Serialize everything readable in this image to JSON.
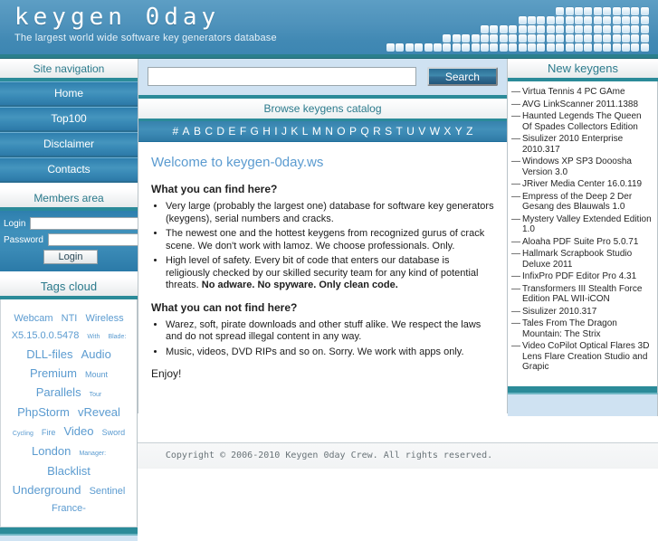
{
  "header": {
    "title": "keygen 0day",
    "tagline": "The largest world wide software key generators database"
  },
  "sidebar_left": {
    "nav_heading": "Site navigation",
    "nav_items": [
      {
        "label": "Home"
      },
      {
        "label": "Top100"
      },
      {
        "label": "Disclaimer"
      },
      {
        "label": "Contacts"
      }
    ],
    "members_heading": "Members area",
    "login_label": "Login",
    "password_label": "Password",
    "login_value": "",
    "password_value": "",
    "login_button": "Login",
    "tags_heading": "Tags cloud",
    "tags": [
      {
        "label": "Webcam",
        "size": "s3"
      },
      {
        "label": "NTI",
        "size": "s3"
      },
      {
        "label": "Wireless",
        "size": "s3"
      },
      {
        "label": "X5.15.0.0.5478",
        "size": "s3"
      },
      {
        "label": "With",
        "size": "s1"
      },
      {
        "label": "Blade:",
        "size": "s1"
      },
      {
        "label": "DLL-files",
        "size": "s4"
      },
      {
        "label": "Audio",
        "size": "s4"
      },
      {
        "label": "Premium",
        "size": "s4"
      },
      {
        "label": "Mount",
        "size": "s2"
      },
      {
        "label": "Parallels",
        "size": "s4"
      },
      {
        "label": "Tour",
        "size": "s1"
      },
      {
        "label": "PhpStorm",
        "size": "s4"
      },
      {
        "label": "vReveal",
        "size": "s4"
      },
      {
        "label": "Cycling",
        "size": "s1"
      },
      {
        "label": "Fire",
        "size": "s2"
      },
      {
        "label": "Video",
        "size": "s4"
      },
      {
        "label": "Sword",
        "size": "s2"
      },
      {
        "label": "London",
        "size": "s4"
      },
      {
        "label": "Manager:",
        "size": "s1"
      },
      {
        "label": "Blacklist",
        "size": "s4"
      },
      {
        "label": "Underground",
        "size": "s4"
      },
      {
        "label": "Sentinel",
        "size": "s3"
      },
      {
        "label": "France-",
        "size": "s3"
      }
    ]
  },
  "search": {
    "value": "",
    "placeholder": "",
    "button_label": "Search"
  },
  "catalog": {
    "heading": "Browse keygens catalog",
    "letters": [
      "#",
      "A",
      "B",
      "C",
      "D",
      "E",
      "F",
      "G",
      "H",
      "I",
      "J",
      "K",
      "L",
      "M",
      "N",
      "O",
      "P",
      "Q",
      "R",
      "S",
      "T",
      "U",
      "V",
      "W",
      "X",
      "Y",
      "Z"
    ]
  },
  "content": {
    "title": "Welcome to keygen-0day.ws",
    "find_heading": "What you can find here?",
    "find_items": [
      "Very large (probably the largest one) database for software key generators (keygens), serial numbers and cracks.",
      "The newest one and the hottest keygens from recognized gurus of crack scene. We don't work with lamoz. We choose professionals. Only.",
      "High level of safety. Every bit of code that enters our database is religiously checked by our skilled security team for any kind of potential threats."
    ],
    "safety_bold": "No adware. No spyware. Only clean code.",
    "notfind_heading_pre": "What you can ",
    "notfind_heading_bold": "not",
    "notfind_heading_post": " find here?",
    "notfind_items": [
      "Warez, soft, pirate downloads and other stuff alike. We respect the laws and do not spread illegal content in any way.",
      "Music, videos, DVD RIPs and so on. Sorry. We work with apps only."
    ],
    "enjoy": "Enjoy!"
  },
  "sidebar_right": {
    "heading": "New keygens",
    "dash": "—",
    "items": [
      {
        "label": "Virtua Tennis 4 PC GAme"
      },
      {
        "label": "AVG LinkScanner 2011.1388"
      },
      {
        "label": "Haunted Legends The Queen Of Spades Collectors Edition"
      },
      {
        "label": "Sisulizer 2010 Enterprise 2010.317"
      },
      {
        "label": "Windows XP SP3 Dooosha Version 3.0"
      },
      {
        "label": "JRiver Media Center 16.0.119"
      },
      {
        "label": "Empress of the Deep 2 Der Gesang des Blauwals 1.0"
      },
      {
        "label": "Mystery Valley Extended Edition 1.0"
      },
      {
        "label": "Aloaha PDF Suite Pro 5.0.71"
      },
      {
        "label": "Hallmark Scrapbook Studio Deluxe 2011"
      },
      {
        "label": "InfixPro PDF Editor Pro 4.31"
      },
      {
        "label": "Transformers III Stealth Force Edition PAL WII-iCON"
      },
      {
        "label": "Sisulizer 2010.317"
      },
      {
        "label": "Tales From The Dragon Mountain: The Strix"
      },
      {
        "label": "Video CoPilot Optical Flares 3D Lens Flare Creation Studio and Grapic"
      }
    ]
  },
  "footer": {
    "copyright": "Copyright © 2006-2010 Keygen 0day Crew. All rights reserved."
  },
  "colors": {
    "header_blue": "#4189b4",
    "teal_rule": "#2b8b99",
    "accent_link": "#5b9bd0",
    "nav_blue": "#3b8cb8",
    "search_bg": "#cfe2f2"
  }
}
